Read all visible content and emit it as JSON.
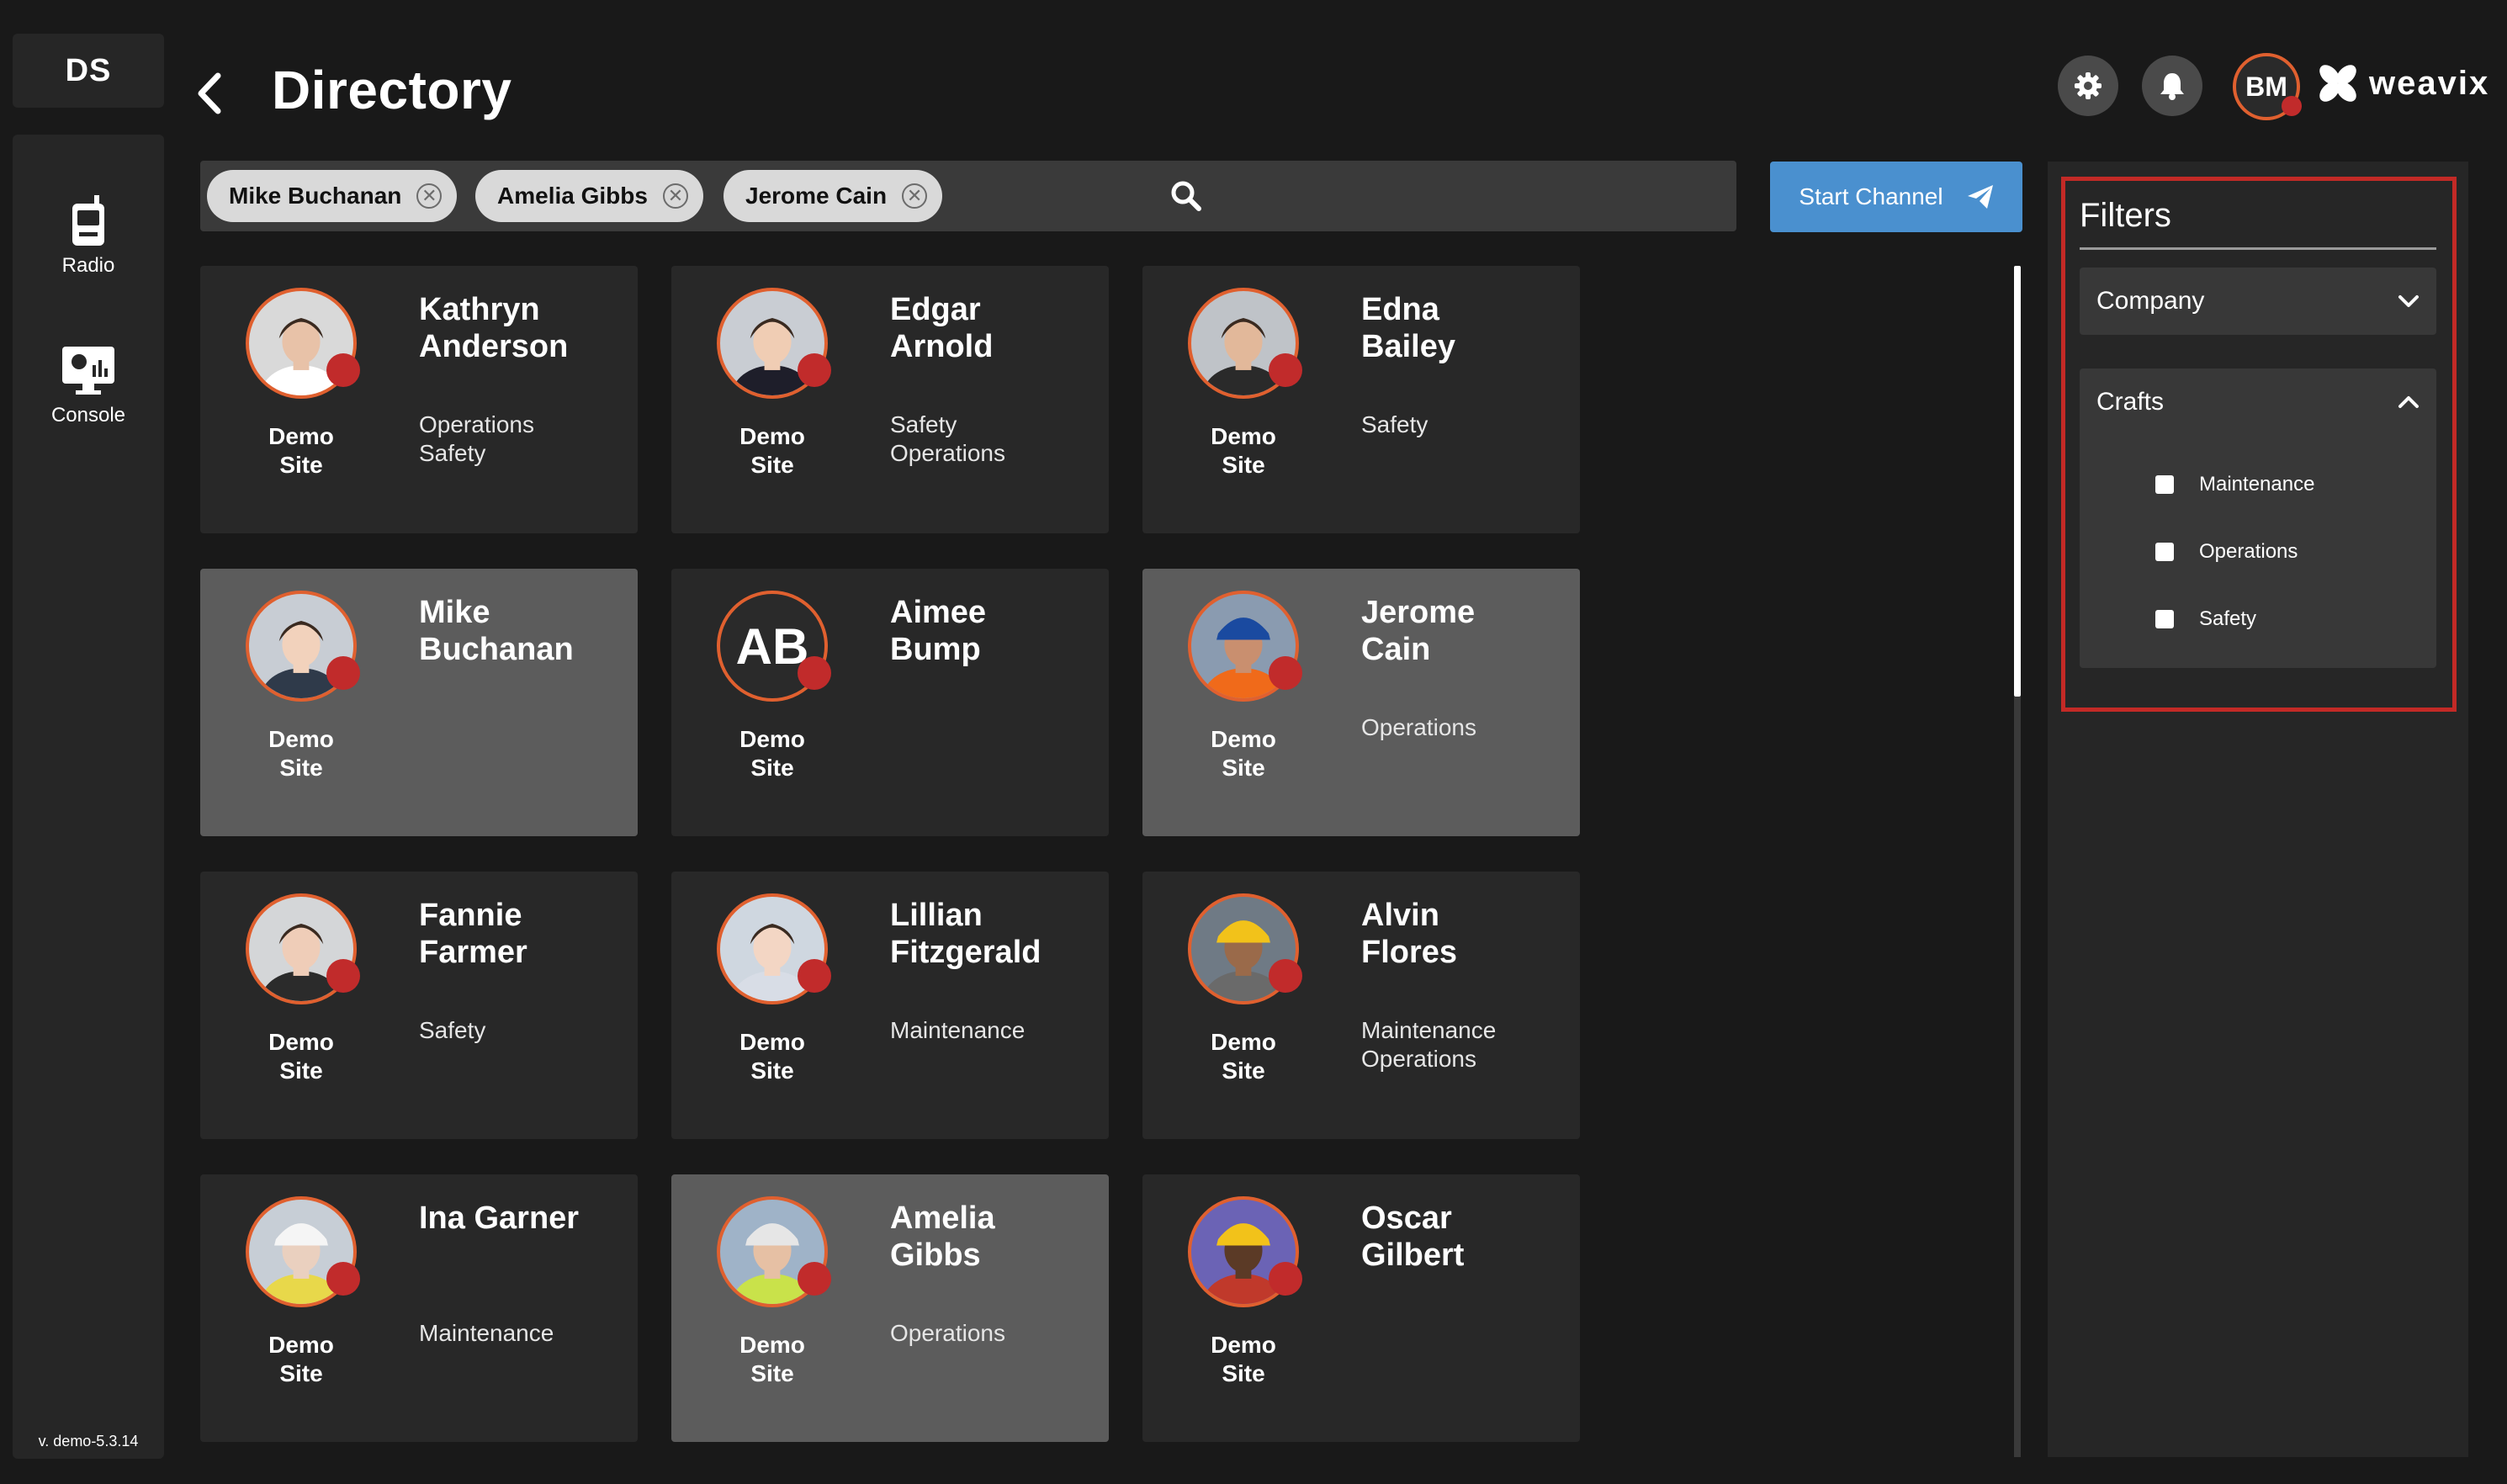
{
  "app": {
    "logo": "DS",
    "brand": "weavix",
    "version": "v. demo-5.3.14"
  },
  "nav": [
    {
      "label": "Radio",
      "icon": "radio-icon"
    },
    {
      "label": "Console",
      "icon": "console-icon"
    }
  ],
  "header": {
    "title": "Directory",
    "user_initials": "BM"
  },
  "search": {
    "chips": [
      "Mike Buchanan",
      "Amelia Gibbs",
      "Jerome Cain"
    ],
    "start_channel_label": "Start Channel"
  },
  "people": [
    {
      "first": "Kathryn",
      "last": "Anderson",
      "site": [
        "Demo",
        "Site"
      ],
      "crafts": [
        "Operations",
        "Safety"
      ],
      "selected": false,
      "avatar": "photo"
    },
    {
      "first": "Edgar",
      "last": "Arnold",
      "site": [
        "Demo",
        "Site"
      ],
      "crafts": [
        "Safety",
        "Operations"
      ],
      "selected": false,
      "avatar": "photo"
    },
    {
      "first": "Edna",
      "last": "Bailey",
      "site": [
        "Demo",
        "Site"
      ],
      "crafts": [
        "Safety"
      ],
      "selected": false,
      "avatar": "photo"
    },
    {
      "first": "Mike",
      "last": "Buchanan",
      "site": [
        "Demo",
        "Site"
      ],
      "crafts": [],
      "selected": true,
      "avatar": "photo"
    },
    {
      "first": "Aimee",
      "last": "Bump",
      "site": [
        "Demo",
        "Site"
      ],
      "crafts": [],
      "selected": false,
      "avatar": "initials",
      "initials": "AB"
    },
    {
      "first": "Jerome",
      "last": "Cain",
      "site": [
        "Demo",
        "Site"
      ],
      "crafts": [
        "Operations"
      ],
      "selected": true,
      "avatar": "photo"
    },
    {
      "first": "Fannie",
      "last": "Farmer",
      "site": [
        "Demo",
        "Site"
      ],
      "crafts": [
        "Safety"
      ],
      "selected": false,
      "avatar": "photo"
    },
    {
      "first": "Lillian",
      "last": "Fitzgerald",
      "site": [
        "Demo",
        "Site"
      ],
      "crafts": [
        "Maintenance"
      ],
      "selected": false,
      "avatar": "photo"
    },
    {
      "first": "Alvin",
      "last": "Flores",
      "site": [
        "Demo",
        "Site"
      ],
      "crafts": [
        "Maintenance",
        "Operations"
      ],
      "selected": false,
      "avatar": "photo"
    },
    {
      "first": "Ina Garner",
      "last": "",
      "site": [
        "Demo",
        "Site"
      ],
      "crafts": [
        "Maintenance"
      ],
      "selected": false,
      "avatar": "photo"
    },
    {
      "first": "Amelia",
      "last": "Gibbs",
      "site": [
        "Demo",
        "Site"
      ],
      "crafts": [
        "Operations"
      ],
      "selected": true,
      "avatar": "photo"
    },
    {
      "first": "Oscar",
      "last": "Gilbert",
      "site": [
        "Demo",
        "Site"
      ],
      "crafts": [],
      "selected": false,
      "avatar": "photo"
    }
  ],
  "filters": {
    "title": "Filters",
    "company_label": "Company",
    "crafts_label": "Crafts",
    "craft_options": [
      "Maintenance",
      "Operations",
      "Safety"
    ]
  },
  "colors": {
    "accent": "#e0602f",
    "status": "#c12b2b",
    "primary": "#4a90cf",
    "highlight": "#c32a26"
  }
}
